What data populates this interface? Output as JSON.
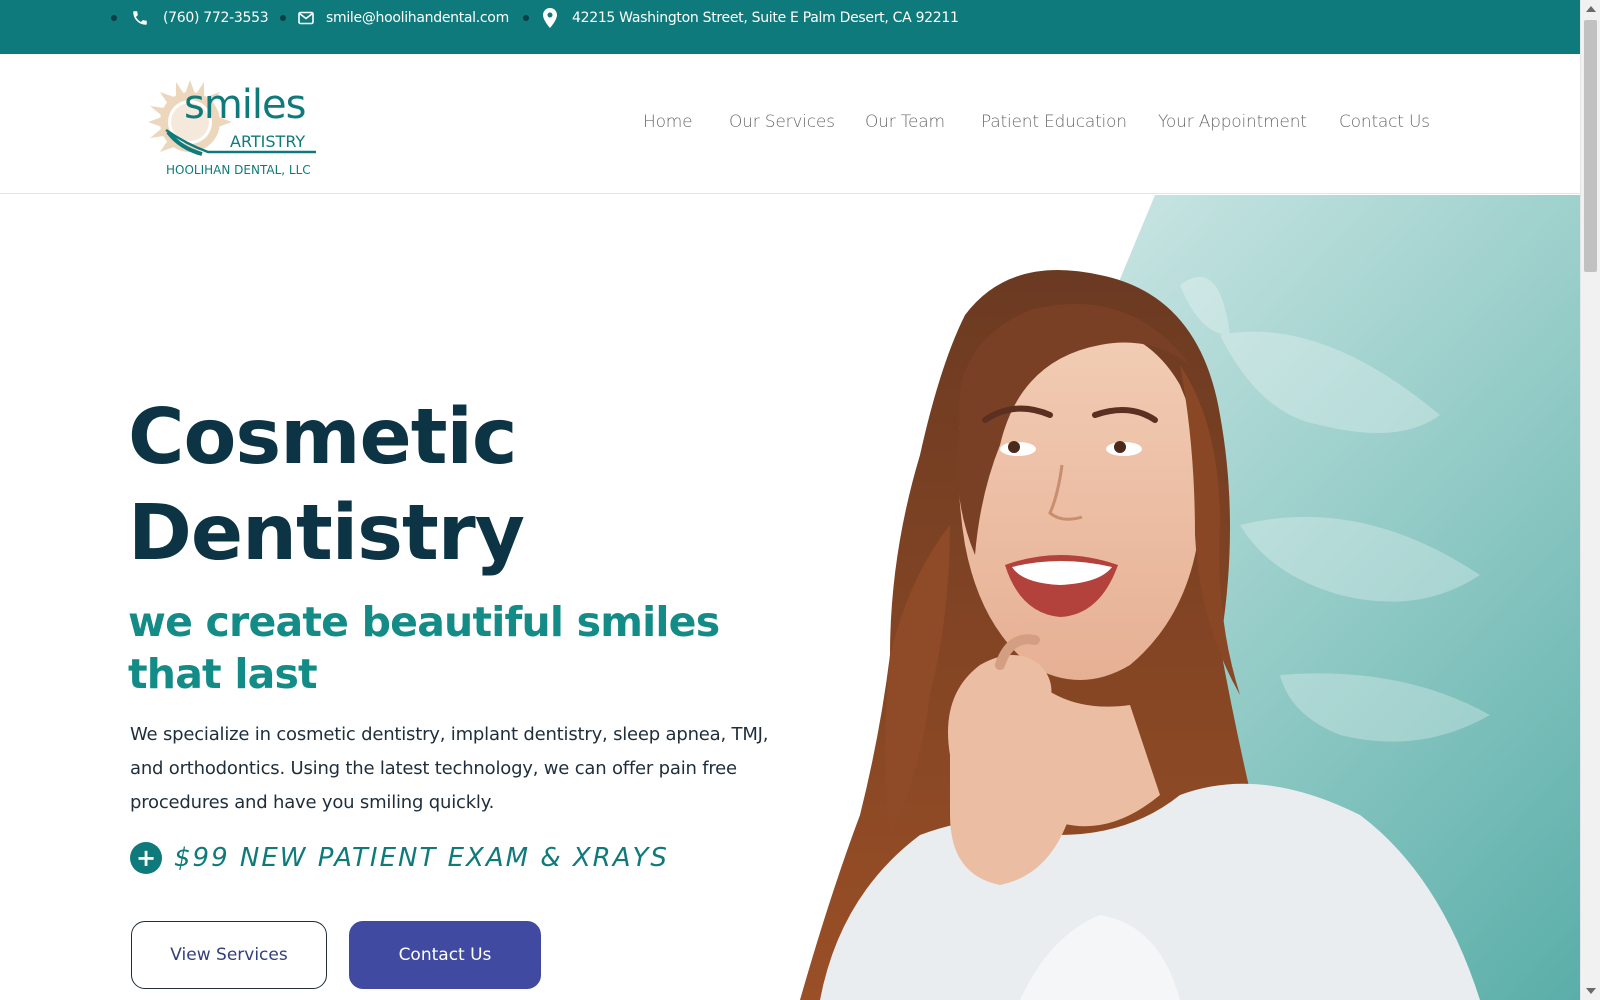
{
  "topbar": {
    "phone": "(760) 772-3553",
    "email": "smile@hoolihandental.com",
    "address": "42215 Washington Street, Suite E Palm Desert, CA 92211",
    "icons": [
      "phone-icon",
      "envelope-icon",
      "map-pin-icon"
    ]
  },
  "logo": {
    "line1": "smiles",
    "line2": "ARTISTRY",
    "line3": "HOOLIHAN DENTAL, LLC"
  },
  "nav": {
    "items": [
      "Home",
      "Our Services",
      "Our Team",
      "Patient Education",
      "Your Appointment",
      "Contact Us"
    ]
  },
  "hero": {
    "title_line1": "Cosmetic",
    "title_line2": "Dentistry",
    "subtitle": "we create beautiful smiles that last",
    "description": "We specialize in cosmetic dentistry, implant dentistry, sleep apnea, TMJ, and orthodontics. Using the latest technology, we can offer pain free procedures and have you smiling quickly.",
    "offer_icon": "plus-circle-icon",
    "offer": "$99 NEW PATIENT EXAM & XRAYS",
    "btn_services": "View Services",
    "btn_contact": "Contact Us"
  },
  "colors": {
    "topbar": "#0f7a7b",
    "heading": "#0c3444",
    "accent": "#138b86",
    "button": "#3f4aa0"
  }
}
